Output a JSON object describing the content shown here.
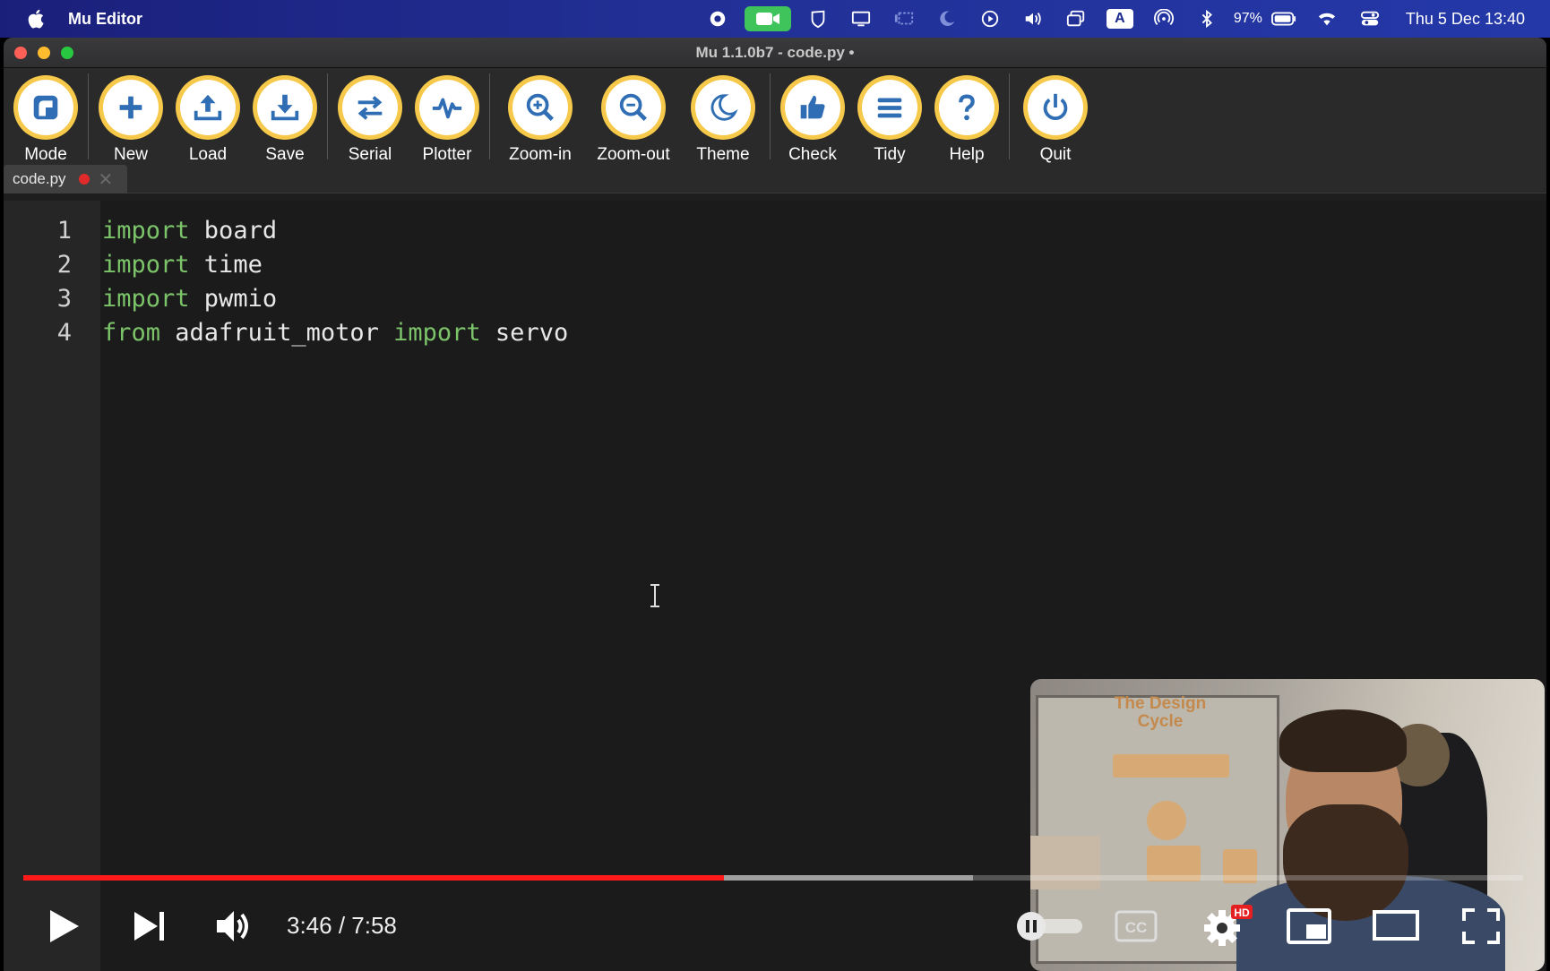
{
  "menubar": {
    "app_name": "Mu Editor",
    "battery": "97%",
    "ime": "A",
    "clock": "Thu 5 Dec  13:40"
  },
  "window": {
    "title": "Mu 1.1.0b7 - code.py •"
  },
  "toolbar": {
    "buttons": [
      {
        "label": "Mode",
        "icon": "mode-icon"
      },
      {
        "label": "New",
        "icon": "plus-icon"
      },
      {
        "label": "Load",
        "icon": "upload-icon"
      },
      {
        "label": "Save",
        "icon": "download-icon"
      },
      {
        "label": "Serial",
        "icon": "arrows-icon"
      },
      {
        "label": "Plotter",
        "icon": "pulse-icon"
      },
      {
        "label": "Zoom-in",
        "icon": "zoom-in-icon"
      },
      {
        "label": "Zoom-out",
        "icon": "zoom-out-icon"
      },
      {
        "label": "Theme",
        "icon": "moon-icon"
      },
      {
        "label": "Check",
        "icon": "thumbs-up-icon"
      },
      {
        "label": "Tidy",
        "icon": "lines-icon"
      },
      {
        "label": "Help",
        "icon": "question-icon"
      },
      {
        "label": "Quit",
        "icon": "power-icon"
      }
    ]
  },
  "tabs": [
    {
      "label": "code.py"
    }
  ],
  "editor": {
    "lines": [
      {
        "no": "1",
        "kw": "import",
        "rest": " board",
        "kw2": "",
        "rest2": ""
      },
      {
        "no": "2",
        "kw": "import",
        "rest": " time",
        "kw2": "",
        "rest2": ""
      },
      {
        "no": "3",
        "kw": "import",
        "rest": " pwmio",
        "kw2": "",
        "rest2": ""
      },
      {
        "no": "4",
        "kw": "from",
        "rest": " adafruit_motor ",
        "kw2": "import",
        "rest2": " servo"
      }
    ]
  },
  "video": {
    "time": "3:46 / 7:58",
    "played_fraction": 0.467,
    "buffered_fraction": 0.633,
    "settings_badge": "HD",
    "cc_label": "CC"
  },
  "pip": {
    "board_title": "The Design Cycle"
  },
  "colors": {
    "keyword": "#7cc46a",
    "button_ring": "#f6c94a",
    "progress": "#ff1a1a"
  }
}
